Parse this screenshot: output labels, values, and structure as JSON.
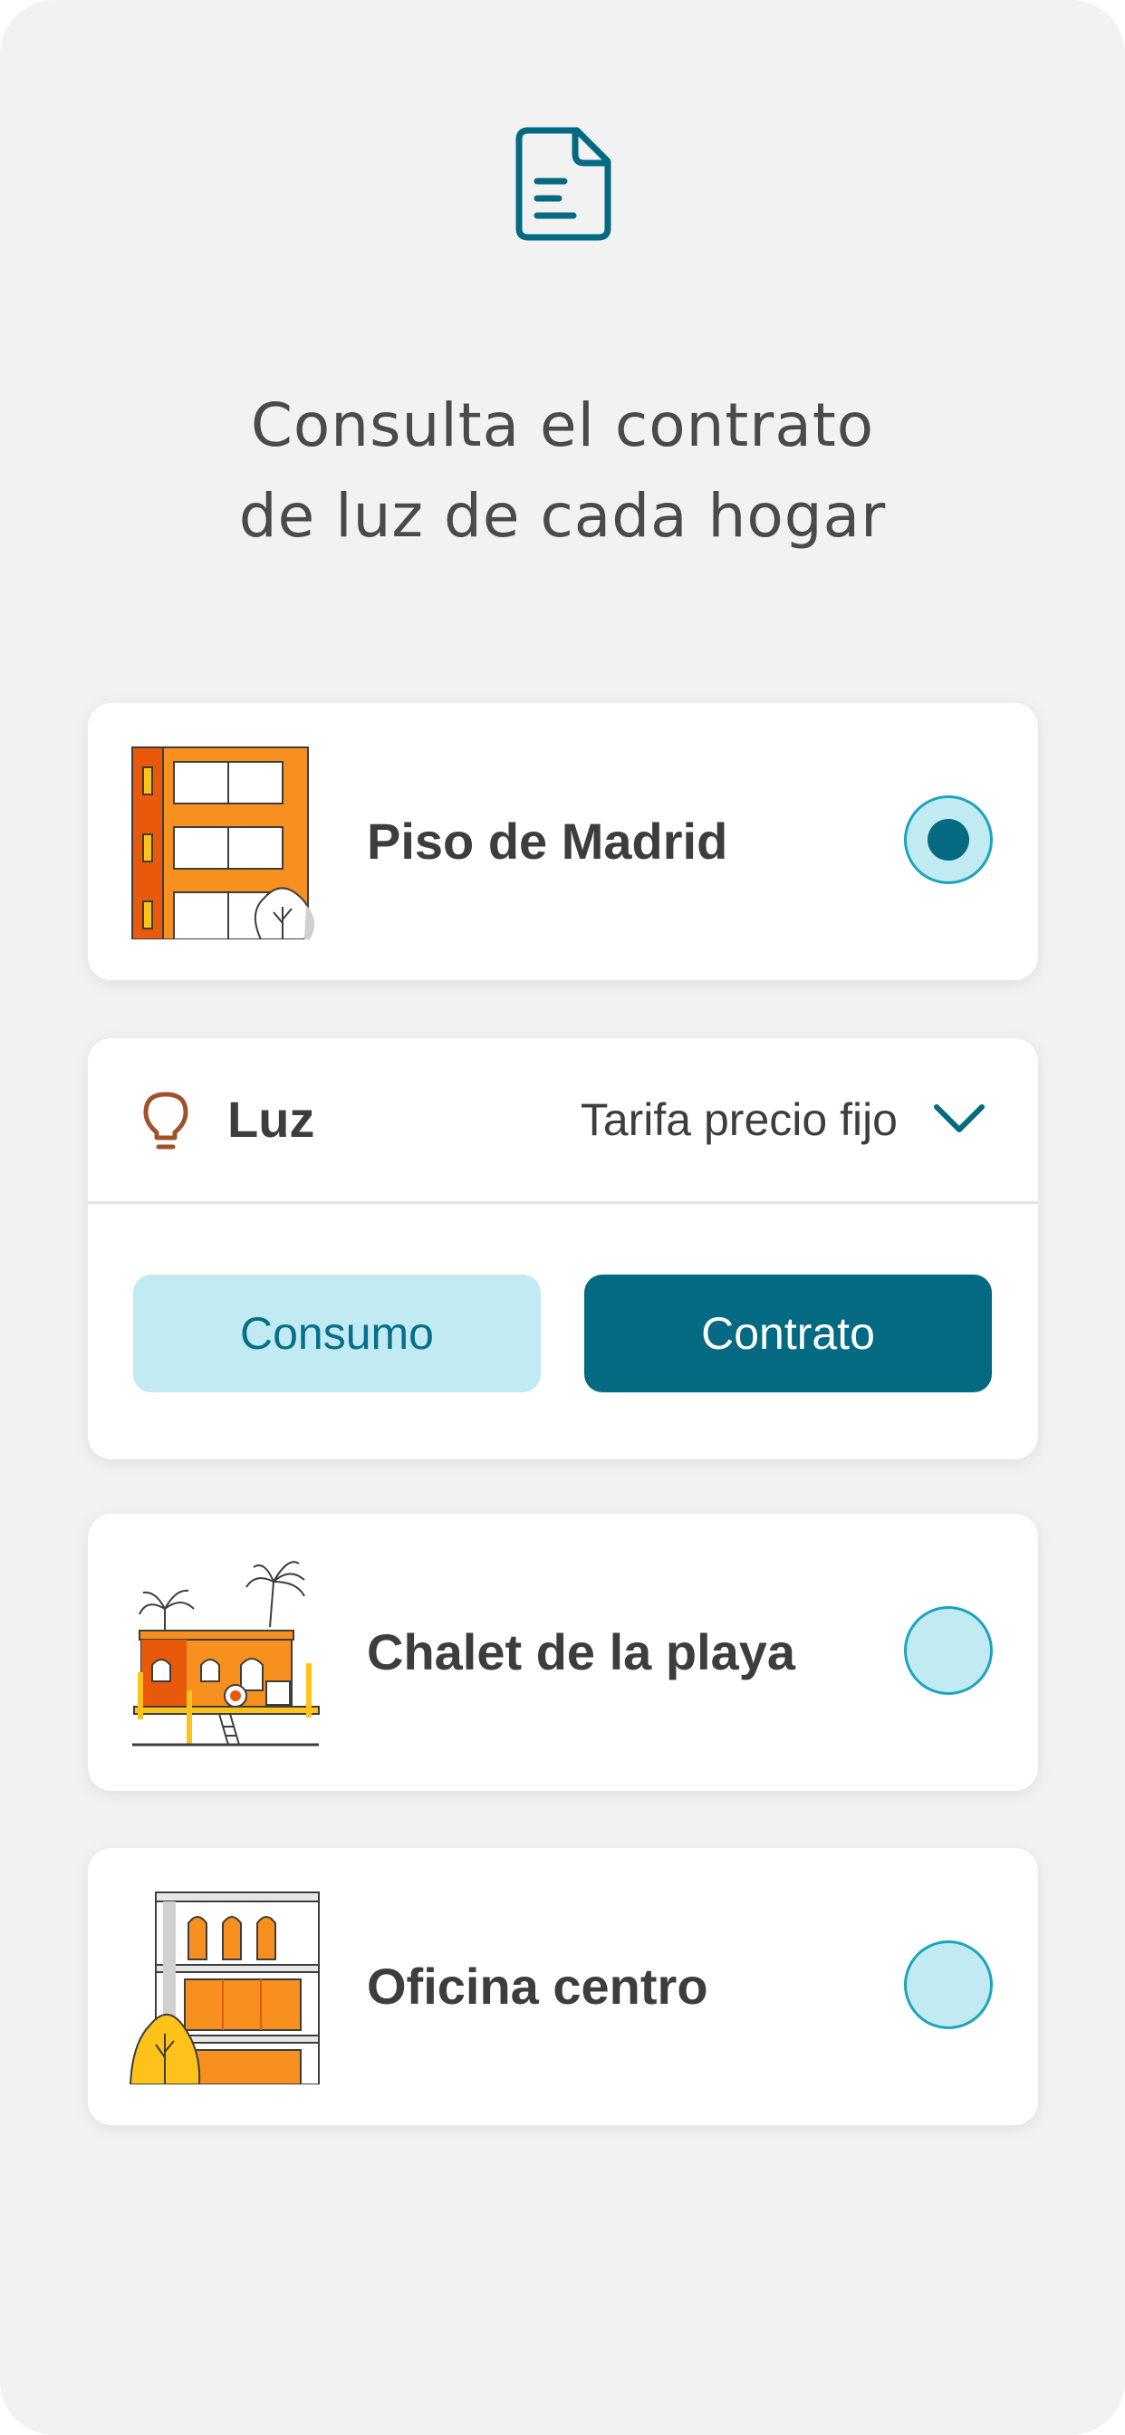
{
  "headline": {
    "line1": "Consulta el  contrato",
    "line2": "de luz de cada hogar"
  },
  "homes": [
    {
      "name": "Piso de Madrid",
      "selected": true,
      "illustration": "apartment-building-illustration"
    },
    {
      "name": "Chalet de la playa",
      "selected": false,
      "illustration": "beach-house-illustration"
    },
    {
      "name": "Oficina centro",
      "selected": false,
      "illustration": "office-building-illustration"
    }
  ],
  "service": {
    "icon": "lightbulb-icon",
    "name": "Luz",
    "tariff": "Tarifa precio fijo",
    "expand_icon": "chevron-down-icon",
    "buttons": {
      "consumo": "Consumo",
      "contrato": "Contrato"
    }
  },
  "colors": {
    "brand_dark": "#046a82",
    "brand_light": "#c2eaf2",
    "accent_orange": "#f7901e",
    "background": "#f2f2f2"
  }
}
